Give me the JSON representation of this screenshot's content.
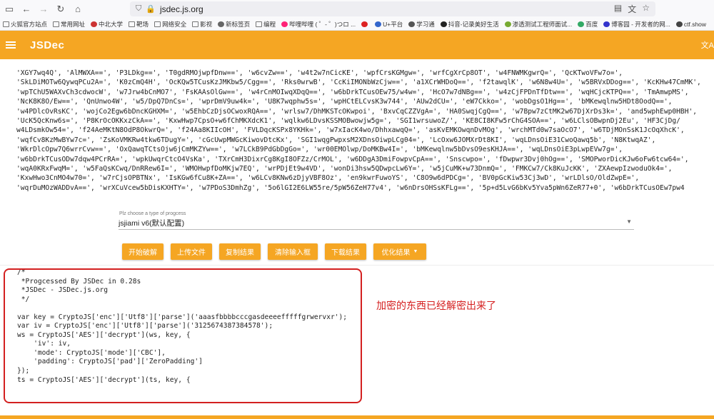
{
  "browser": {
    "url": "jsdec.js.org",
    "nav": [
      "back",
      "forward",
      "reload",
      "home"
    ]
  },
  "bookmarks": [
    "火狐官方站点",
    "常用网址",
    "中北大学",
    "靶场",
    "网络安全",
    "影视",
    "新标签页",
    "编程",
    "哔哩哔哩 ( ゜- ゜)つロ ...",
    "",
    "U+平台",
    "学习通",
    "抖音-记录美好生活",
    "渗透测试工程师面试...",
    "百度",
    "博客园 - 开发者的网...",
    "ctf.show"
  ],
  "app": {
    "title": "JSDec",
    "header_right": "文A"
  },
  "input_lines": [
    "'XGY7wq4Q', 'AlMWXA==', 'P3LDkg==', 'T0gdRMOjwpfDnw==', 'w6cvZw==', 'w4t2w7nCicKE', 'wpfCrsKGMgw=', 'wrfCgXrCp8OT', 'w4FNWMKgwrQ=', 'QcKTwoVFw7o=',",
    "'SkLDiMOTw6QywqPCu2A=', 'K0zCmQ4H', 'OcKQw5TCusKzJMKbw5/Cgg==', 'Rks0wrwB', 'CcKiIMONbWzCjw==', 'a1XCrWHDoQ==', 'f2tawqlK', 'w6N8w4U=', 'w5BRVxDDog==', 'KcKHw47CmMK',",
    "'wpTChU5WAXvCh3cdwocW', 'w7Jrw4bCnMO7', 'FsKAAsOlGw==', 'w4rCnMOIwqXDqQ==', 'w6bDrkTCusOEw75/w4w=', 'HcO7w7dNBg==', 'w4zCjFPDnTfDtw==', 'wqHCjcKTPQ==', 'TmAmwpMS',",
    "'NcK8K8O/Ew==', 'QnUnwo4W', 'w5/DpQ7DnCs=', 'wprDmV9uw4k=', 'U8K7wqphw5s=', 'wpHCtELCvsK3w744', 'AUw2dCU=', 'eW7Ckko=', 'wobDgsO1Hg==', 'bMKewqlnw5HDt8OodQ==',",
    "'w4PDlcOvRsKC', 'wojCo2Egw6bDncKGHXM=', 'w5EhbCzDjsOCwoxRQA==', 'wrlsw7/DhMKSTcOKwpoi', 'BxvCqCZZVgA=', 'HA0SwqjCgQ==', 'w7Bpw7zCtMK2w67DjXrDs3k=', 'and5wphEwp0HBH',",
    "'UcK5QcKnw6s=', 'P8KrOcOKKxzCkA==', 'KxwHwp7CpsO+w6fChMKXdcK1', 'wqlkw6LDvsKSSMOBwowjw5g=', 'SGI1wrsuwoZ/', 'KE8CI8KFw5rChG4SOA==', 'w6LClsOBwpnDj2Eu', 'HF3CjDg/",
    "w4LDsmkOw54=', 'f24AeMKtN8OdP8OkwrQ=', 'f24Aa8KIIcOH', 'FVLDqcKSPx8YKHk=', 'w7xIacK4wo/DhhxawqQ=', 'asKvEMKOwqnDvMOg', 'wrchMTd0w7saOcO7', 'w6TDjMOnSsK1JcOqXhcK',",
    "'wqfCv8KzMwBYw7c=', 'ZsKoVMKRw4tkw6TDugY=', 'cGcUwpMWGcKiwovDtcKx', 'SGI1wqgPwpxsM2XDnsOiwpLCg04=', 'LcOxw6JOMXrDt8KI', 'wqLDnsOiE31CwoQawq5b', 'N8KtwqAZ',",
    "'WkrDlcOpw7Q6wrrCvw==', 'OxQawqTCtsOjw6jCmMKZYw==', 'w7LCkB9PdGbDgGo=', 'wr00EMOlwp/DoMKBw4I=', 'bMKewqlnw5bDvsO9esKHJA==', 'wqLDnsOiE3pLwpEVw7g=',",
    "'w6bDrkTCusODw7dqw4PCrRA=', 'wpkUwqrCtcO4VsKa', 'TXrCmH3DixrCg8KgI8OFZz/CrMOL', 'w6DDgA3DmiFowpvCpA==', 'Snscwpo=', 'fDwpwr3Dvj0hOg==', 'SMOPworDicKJw6oFw6tcw64=',",
    "'wqA0KRxFwqM=', 'w5FaQsKCwq/DnRRew6I=', 'WMOHwpfDoMKjw7EQ', 'wrPDjEt9w4VD', 'wonDi3hsw5QDwpcLw6Y=', 'w5jCuMK+w73DnmQ=', 'FMKCw7/Ck8KuJcKK', 'ZXAewpIzwoduOk4=',",
    "'KxwHwo3CnMO4w70=', 'w7rCjsOPBTNx', 'IsKGw6fCu8K+ZA==', 'w6LCv8KNw6zDjyVBF8Oz', 'en9kwrFuwoYS', 'C8O9w6dPDCg=', 'BV0pGcKiw53Cj3wD', 'wrLDlsO/OldZwpE=',",
    "'wqrDuMOzWADDvA==', 'wrXCuVcew5bDisKXHTY=', 'w7PDoS3DmhZg', '5o6lGI2E6LW55re/5pW56ZeH77v4', 'w6nDrsOHSsKFLg==', '5p+d5LvG6bKv5Yva5pWn6ZeR77+0', 'w6bDrkTCusOEw7pw4"
  ],
  "selector": {
    "label": "Plz choose a type of progcess",
    "value": "jsjiami v6(默认配置)"
  },
  "buttons": [
    "开始破解",
    "上传文件",
    "复制结果",
    "清除输入框",
    "下载结果",
    "优化结果"
  ],
  "output_lines": [
    "/*",
    " *Progcessed By JSDec in 0.28s",
    " *JSDec - JSDec.js.org",
    " */",
    "",
    "var key = CryptoJS['enc']['Utf8']['parse']('aaasfbbbbcccgasdeeeefffffgrwervxr');",
    "var iv = CryptoJS['enc']['Utf8']['parse']('3125674387384578');",
    "ws = CryptoJS['AES']['decrypt'](ws, key, {",
    "    'iv': iv,",
    "    'mode': CryptoJS['mode']['CBC'],",
    "    'padding': CryptoJS['pad']['ZeroPadding']",
    "});",
    "ts = CryptoJS['AES']['decrypt'](ts, key, {"
  ],
  "annotation": "加密的东西已经解密出来了",
  "colors": {
    "accent": "#f5a623",
    "highlight": "#d32020"
  }
}
